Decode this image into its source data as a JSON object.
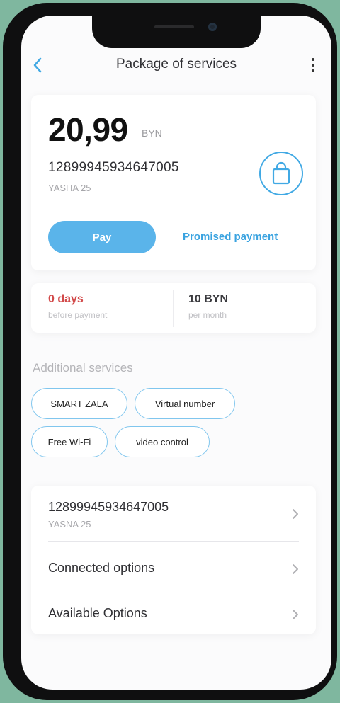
{
  "header": {
    "title": "Package of services",
    "back_icon": "chevron-left-icon",
    "menu_icon": "more-vertical-icon"
  },
  "balance": {
    "amount": "20,99",
    "currency": "BYN",
    "account_number": "12899945934647005",
    "account_name": "YASHA 25",
    "bag_icon": "shopping-bag-icon",
    "pay_label": "Pay",
    "promised_payment_label": "Promised payment"
  },
  "stats": {
    "days_value": "0 days",
    "days_label": "before payment",
    "monthly_value": "10 BYN",
    "monthly_label": "per month"
  },
  "additional_services": {
    "title": "Additional services",
    "chips": [
      "SMART ZALA",
      "Virtual number",
      "Free Wi-Fi",
      "video control"
    ]
  },
  "options_list": {
    "account_number": "12899945934647005",
    "account_name": "YASNA 25",
    "connected_options": "Connected options",
    "available_options": "Available Options"
  },
  "colors": {
    "accent": "#41a9e4",
    "pay_button": "#5ab4ea",
    "alert": "#d24a4a",
    "background": "#7fb79f"
  }
}
